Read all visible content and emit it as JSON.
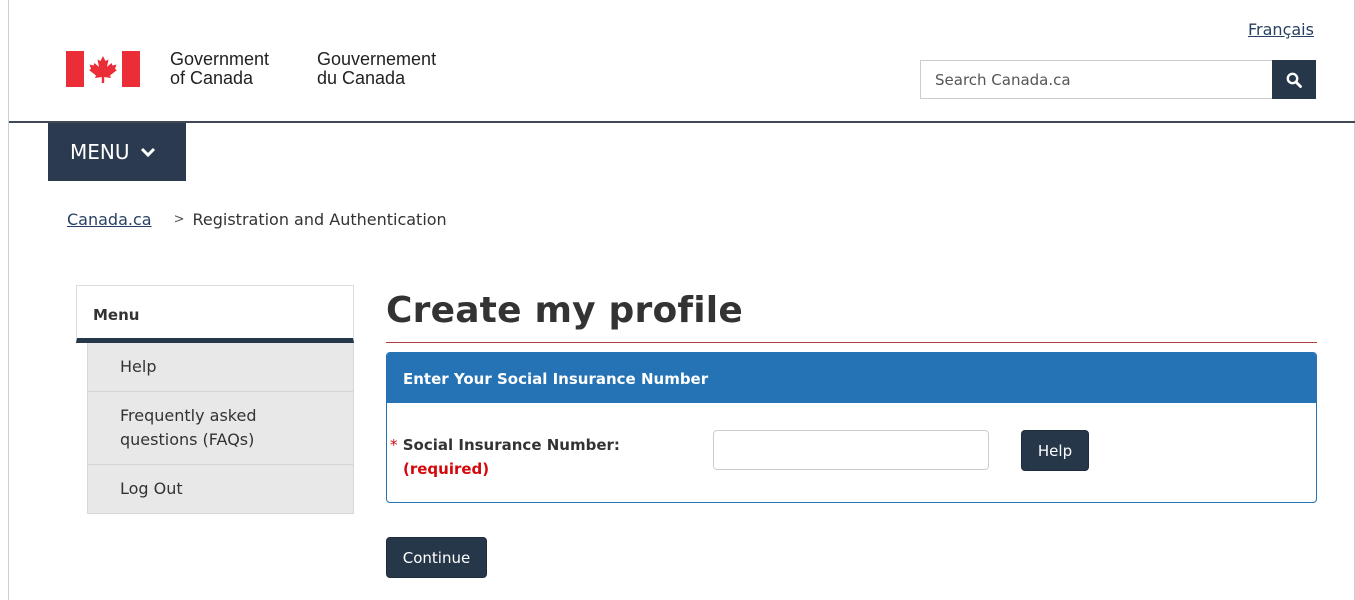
{
  "header": {
    "language_link": "Français",
    "signature_en": [
      "Government",
      "of Canada"
    ],
    "signature_fr": [
      "Gouvernement",
      "du Canada"
    ],
    "search_placeholder": "Search Canada.ca",
    "search_icon": "search-icon",
    "flag_icon": "canada-flag-icon",
    "flag_color": "#eb2d37"
  },
  "nav": {
    "menu_label": "MENU",
    "menu_icon": "chevron-down-icon"
  },
  "breadcrumb": {
    "home": "Canada.ca",
    "separator": ">",
    "current": "Registration and Authentication"
  },
  "sidebar": {
    "title": "Menu",
    "items": [
      {
        "label": "Help"
      },
      {
        "label": "Frequently asked questions (FAQs)"
      },
      {
        "label": "Log Out"
      }
    ]
  },
  "main": {
    "title": "Create my profile",
    "panel_title": "Enter Your Social Insurance Number",
    "field_star": "*",
    "field_label": "Social Insurance Number:",
    "field_required": "(required)",
    "field_value": "",
    "help_label": "Help",
    "continue_label": "Continue"
  },
  "colors": {
    "brand_dark": "#26374a",
    "panel_blue": "#2572b4",
    "required_red": "#d3080c",
    "title_rule": "#af3c43"
  }
}
